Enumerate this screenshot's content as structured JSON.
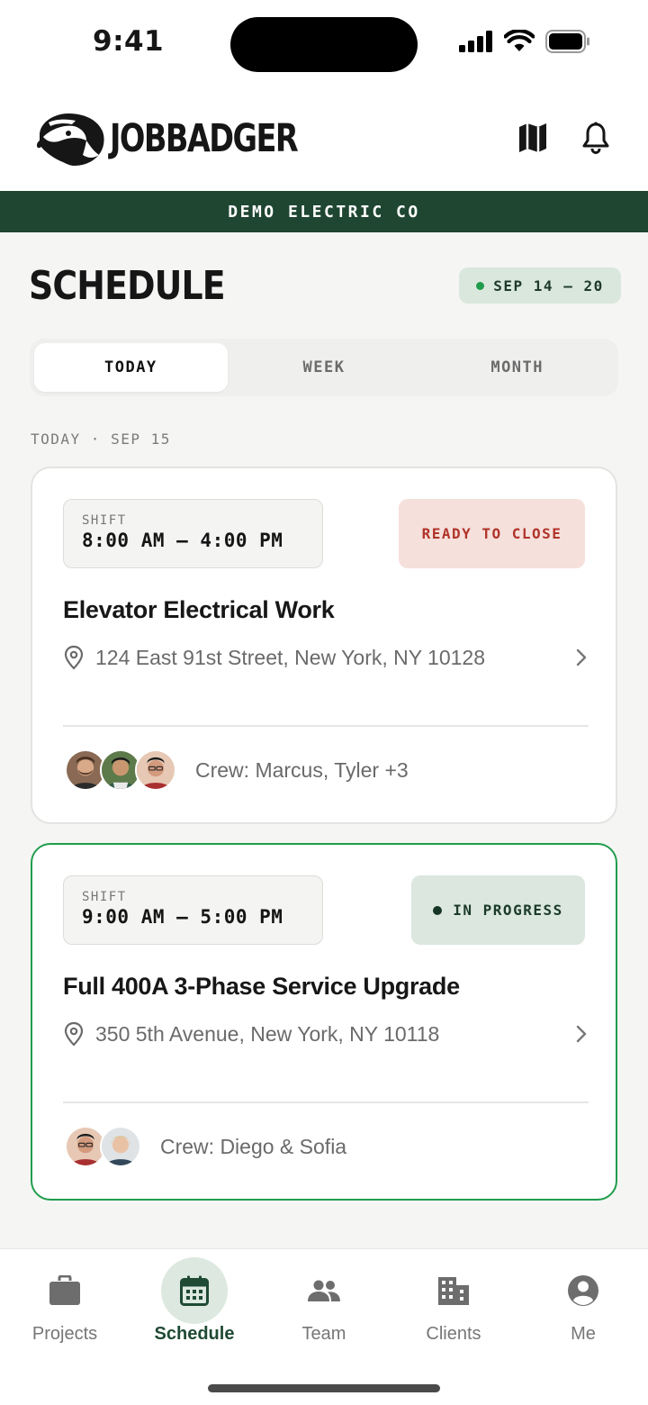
{
  "status_bar": {
    "time": "9:41"
  },
  "header": {
    "brand": "JOBBADGER"
  },
  "company": {
    "name": "DEMO ELECTRIC CO"
  },
  "page": {
    "title": "SCHEDULE",
    "date_range": "SEP 14 – 20"
  },
  "tabs": [
    {
      "label": "TODAY",
      "active": true
    },
    {
      "label": "WEEK",
      "active": false
    },
    {
      "label": "MONTH",
      "active": false
    }
  ],
  "section_label": "TODAY · SEP 15",
  "jobs": [
    {
      "shift_label": "SHIFT",
      "shift_time": "8:00 AM – 4:00 PM",
      "status": "READY TO CLOSE",
      "title": "Elevator Electrical Work",
      "address": "124 East 91st Street, New York, NY 10128",
      "crew": "Crew: Marcus, Tyler +3"
    },
    {
      "shift_label": "SHIFT",
      "shift_time": "9:00 AM – 5:00 PM",
      "status": "IN PROGRESS",
      "title": "Full 400A 3-Phase Service Upgrade",
      "address": "350 5th Avenue, New York, NY 10118",
      "crew": "Crew: Diego & Sofia"
    }
  ],
  "nav": [
    {
      "label": "Projects",
      "icon": "briefcase-icon",
      "active": false
    },
    {
      "label": "Schedule",
      "icon": "calendar-icon",
      "active": true
    },
    {
      "label": "Team",
      "icon": "people-icon",
      "active": false
    },
    {
      "label": "Clients",
      "icon": "building-icon",
      "active": false
    },
    {
      "label": "Me",
      "icon": "account-circle-icon",
      "active": false
    }
  ],
  "colors": {
    "brand_green": "#1e4631",
    "active_border": "#1f9d4c",
    "ready_badge_bg": "#f6e0dc",
    "ready_badge_text": "#b0342a",
    "progress_badge_bg": "#dbe7df"
  }
}
